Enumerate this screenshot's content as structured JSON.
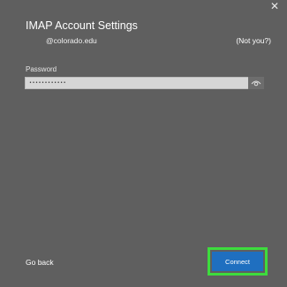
{
  "dialog": {
    "close_glyph": "✕",
    "title": "IMAP Account Settings",
    "email": "@colorado.edu",
    "not_you": "(Not you?)"
  },
  "password": {
    "label": "Password",
    "value": "••••••••••••",
    "reveal_icon": "eye-icon"
  },
  "footer": {
    "go_back": "Go back",
    "connect": "Connect",
    "highlight_color": "#3ddc3d",
    "connect_color": "#1f6fc0"
  }
}
